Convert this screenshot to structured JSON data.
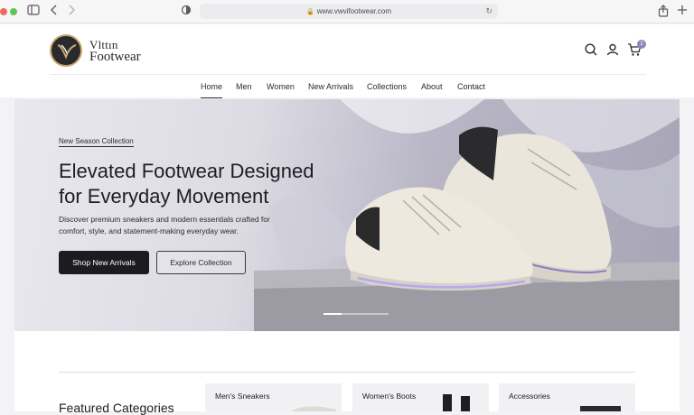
{
  "browser": {
    "url": "www.vwvifootwear.com",
    "icons": [
      "sidebar-icon",
      "back-icon",
      "forward-icon",
      "privacy-shield-icon",
      "reload-icon",
      "share-icon",
      "new-tab-icon"
    ]
  },
  "header": {
    "logo_line1": "Vlttın",
    "logo_line2": "Footwear",
    "icons": [
      "search-icon",
      "account-icon",
      "cart-icon"
    ],
    "cart_count": "2"
  },
  "nav": {
    "items": [
      {
        "label": "Home",
        "active": true
      },
      {
        "label": "Men"
      },
      {
        "label": "Women"
      },
      {
        "label": "New Arrivals"
      },
      {
        "label": "Collections"
      },
      {
        "label": "About"
      },
      {
        "label": "Contact"
      }
    ]
  },
  "hero": {
    "eyebrow": "New Season Collection",
    "title_line1": "Elevated Footwear Designed",
    "title_line2": "for Everyday Movement",
    "description_line1": "Discover premium sneakers and modern essentials crafted for",
    "description_line2": "comfort, style, and statement-making everyday wear.",
    "primary_button": "Shop New Arrivals",
    "secondary_button": "Explore Collection",
    "slide_index": 1,
    "slide_count": 4
  },
  "categories": {
    "title": "Featured Categories",
    "items": [
      {
        "label": "Men's Sneakers"
      },
      {
        "label": "Women's Boots"
      },
      {
        "label": "Accessories"
      }
    ]
  },
  "colors": {
    "accent": "#1c1b1f",
    "brand_gold": "#c9a86a",
    "badge": "#8a8ab3"
  }
}
